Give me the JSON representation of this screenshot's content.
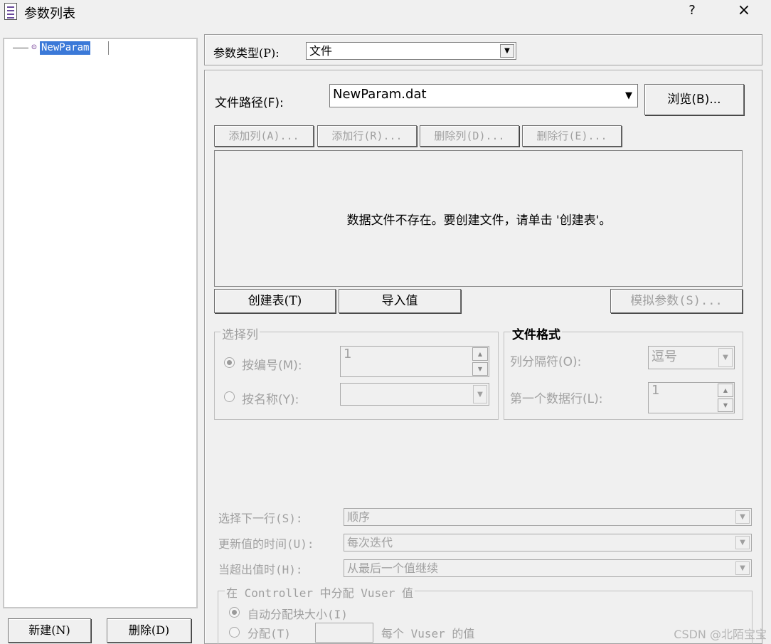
{
  "window": {
    "title": "参数列表",
    "help": "?",
    "close": "×"
  },
  "tree": {
    "param_icon": "⊙",
    "selected_item": "NewParam"
  },
  "left_buttons": {
    "new": "新建(N)",
    "delete": "删除(D)"
  },
  "param_type": {
    "label": "参数类型(P):",
    "value": "文件"
  },
  "file": {
    "path_label": "文件路径(F):",
    "path_value": "NewParam.dat",
    "browse": "浏览(B)..."
  },
  "table_buttons": {
    "add_column": "添加列(A)...",
    "add_row": "添加行(R)...",
    "delete_column": "删除列(D)...",
    "delete_row": "删除行(E)..."
  },
  "data_area": {
    "message": "数据文件不存在。要创建文件，请单击 '创建表'。"
  },
  "action_buttons": {
    "create_table": "创建表(T)",
    "import_values": "导入值",
    "simulate": "模拟参数(S)..."
  },
  "select_column": {
    "title": "选择列",
    "by_number_label": "按编号(M):",
    "by_number_value": "1",
    "by_number_selected": true,
    "by_name_label": "按名称(Y):",
    "by_name_value": ""
  },
  "file_format": {
    "title": "文件格式",
    "delimiter_label": "列分隔符(O):",
    "delimiter_value": "逗号",
    "first_row_label": "第一个数据行(L):",
    "first_row_value": "1"
  },
  "options": {
    "next_row_label": "选择下一行(S):",
    "next_row_value": "顺序",
    "update_label": "更新值的时间(U):",
    "update_value": "每次迭代",
    "out_of_values_label": "当超出值时(H):",
    "out_of_values_value": "从最后一个值继续"
  },
  "vuser_allocation": {
    "title": "在 Controller 中分配 Vuser 值",
    "auto_label": "自动分配块大小(I)",
    "alloc_label": "分配(T)",
    "alloc_value": "",
    "per_vuser_label": "每个 Vuser 的值"
  },
  "watermark": "CSDN @北陌宝宝",
  "colors": {
    "selection": "#3b79d8",
    "disabled_text": "#a0a0a0",
    "window_bg": "#f0f0f0"
  }
}
